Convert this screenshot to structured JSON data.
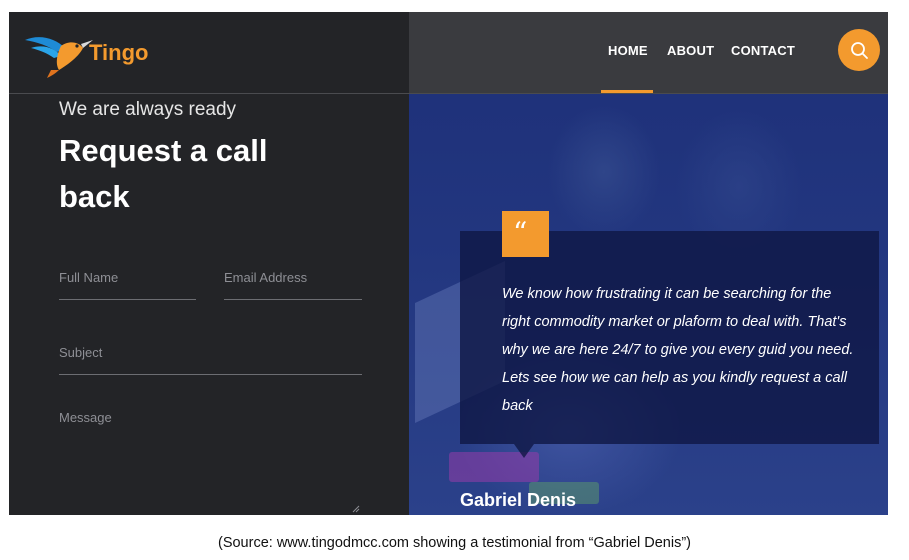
{
  "header": {
    "brand": "Tingo",
    "nav": [
      {
        "label": "HOME"
      },
      {
        "label": "ABOUT"
      },
      {
        "label": "CONTACT"
      }
    ],
    "active_nav": "HOME",
    "search_icon": "search-icon"
  },
  "form": {
    "kicker": "We are always ready",
    "headline": "Request a call back",
    "fields": {
      "full_name": "Full Name",
      "email": "Email Address",
      "subject": "Subject",
      "message": "Message"
    }
  },
  "testimonial": {
    "quote_icon": "quote-icon",
    "text": "We know how frustrating it can be searching for the right commodity market or plaform to deal with. That's why we are here 24/7 to give you every guid you need. Lets see how we can help as you kindly request a call back",
    "author": "Gabriel Denis"
  },
  "caption": "(Source: www.tingodmcc.com showing a testimonial from “Gabriel Denis”)",
  "colors": {
    "accent": "#f39a2e",
    "panel": "#232427",
    "header": "#3a3b3f",
    "overlay": "#1d2f78"
  }
}
